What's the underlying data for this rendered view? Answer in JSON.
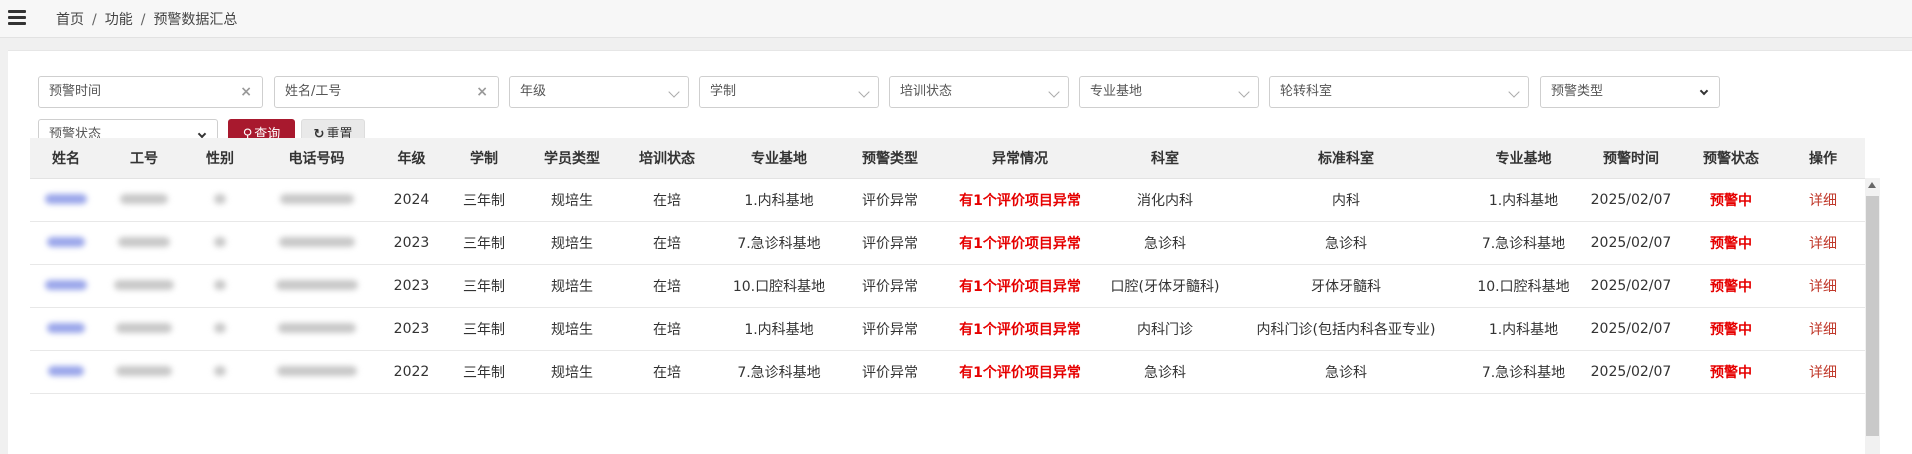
{
  "breadcrumb": {
    "home": "首页",
    "sep": "/",
    "section": "功能",
    "current": "预警数据汇总"
  },
  "filters": {
    "warn_time": "预警时间",
    "name_id": "姓名/工号",
    "grade": "年级",
    "system": "学制",
    "train_status": "培训状态",
    "base": "专业基地",
    "rotation": "轮转科室",
    "warn_type": "预警类型",
    "warn_status": "预警状态"
  },
  "buttons": {
    "query": "查询",
    "reset": "重置"
  },
  "table": {
    "headers": [
      "姓名",
      "工号",
      "性别",
      "电话号码",
      "年级",
      "学制",
      "学员类型",
      "培训状态",
      "专业基地",
      "预警类型",
      "异常情况",
      "科室",
      "标准科室",
      "专业基地",
      "预警时间",
      "预警状态",
      "操作"
    ],
    "rows": [
      [
        "2024",
        "三年制",
        "规培生",
        "在培",
        "1.内科基地",
        "评价异常",
        "有1个评价项目异常",
        "消化内科",
        "内科",
        "1.内科基地",
        "2025/02/07",
        "预警中",
        "详细"
      ],
      [
        "2023",
        "三年制",
        "规培生",
        "在培",
        "7.急诊科基地",
        "评价异常",
        "有1个评价项目异常",
        "急诊科",
        "急诊科",
        "7.急诊科基地",
        "2025/02/07",
        "预警中",
        "详细"
      ],
      [
        "2023",
        "三年制",
        "规培生",
        "在培",
        "10.口腔科基地",
        "评价异常",
        "有1个评价项目异常",
        "口腔(牙体牙髓科)",
        "牙体牙髓科",
        "10.口腔科基地",
        "2025/02/07",
        "预警中",
        "详细"
      ],
      [
        "2023",
        "三年制",
        "规培生",
        "在培",
        "1.内科基地",
        "评价异常",
        "有1个评价项目异常",
        "内科门诊",
        "内科门诊(包括内科各亚专业)",
        "1.内科基地",
        "2025/02/07",
        "预警中",
        "详细"
      ],
      [
        "2022",
        "三年制",
        "规培生",
        "在培",
        "7.急诊科基地",
        "评价异常",
        "有1个评价项目异常",
        "急诊科",
        "急诊科",
        "7.急诊科基地",
        "2025/02/07",
        "预警中",
        "详细"
      ]
    ]
  },
  "icons": {
    "menu": "hamburger-icon",
    "search": "search-icon",
    "reset": "refresh-icon",
    "clear": "clear-icon",
    "dropdown": "chevron-down-icon"
  },
  "colors": {
    "primary": "#a8192e",
    "warn": "#e60000",
    "link": "#c0392b"
  }
}
